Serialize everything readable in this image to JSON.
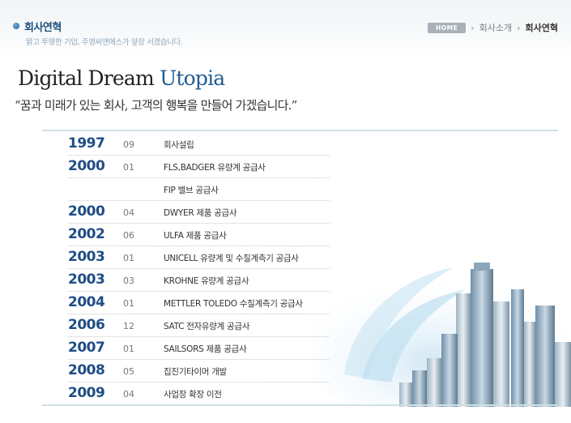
{
  "header": {
    "title": "회사연혁",
    "subtitle": "맑고 투명한 기업, 주영씨앤에스가 앞장 서겠습니다."
  },
  "breadcrumb": {
    "home": "HOME",
    "items": [
      "회사소개"
    ],
    "current": "회사연혁"
  },
  "headline": {
    "main": "Digital Dream ",
    "accent": "Utopia"
  },
  "slogan": "“꿈과 미래가 있는 회사, 고객의 행복을 만들어 가겠습니다.”",
  "history": [
    {
      "year": "1997",
      "month": "09",
      "event": "회사설립"
    },
    {
      "year": "2000",
      "month": "01",
      "event": "FLS,BADGER 유량계 공급사"
    },
    {
      "year": "",
      "month": "",
      "event": "FIP 밸브 공급사"
    },
    {
      "year": "2000",
      "month": "04",
      "event": "DWYER 제품 공급사"
    },
    {
      "year": "2002",
      "month": "06",
      "event": "ULFA 제품 공급사"
    },
    {
      "year": "2003",
      "month": "01",
      "event": "UNICELL 유량계 및 수질계측기 공급사"
    },
    {
      "year": "2003",
      "month": "03",
      "event": "KROHNE 유량계 공급사"
    },
    {
      "year": "2004",
      "month": "01",
      "event": "METTLER TOLEDO 수질계측기 공급사"
    },
    {
      "year": "2006",
      "month": "12",
      "event": "SATC 전자유량계 공급사"
    },
    {
      "year": "2007",
      "month": "01",
      "event": "SAILSORS 제품 공급사"
    },
    {
      "year": "2008",
      "month": "05",
      "event": "집진기타이머 개발"
    },
    {
      "year": "2009",
      "month": "04",
      "event": "사업장 확장 이전"
    }
  ],
  "colors": {
    "year": "#1f4d86",
    "accent": "#1e5d93"
  },
  "icons": [
    "bullet-dot-icon",
    "chevron-right-icon"
  ]
}
